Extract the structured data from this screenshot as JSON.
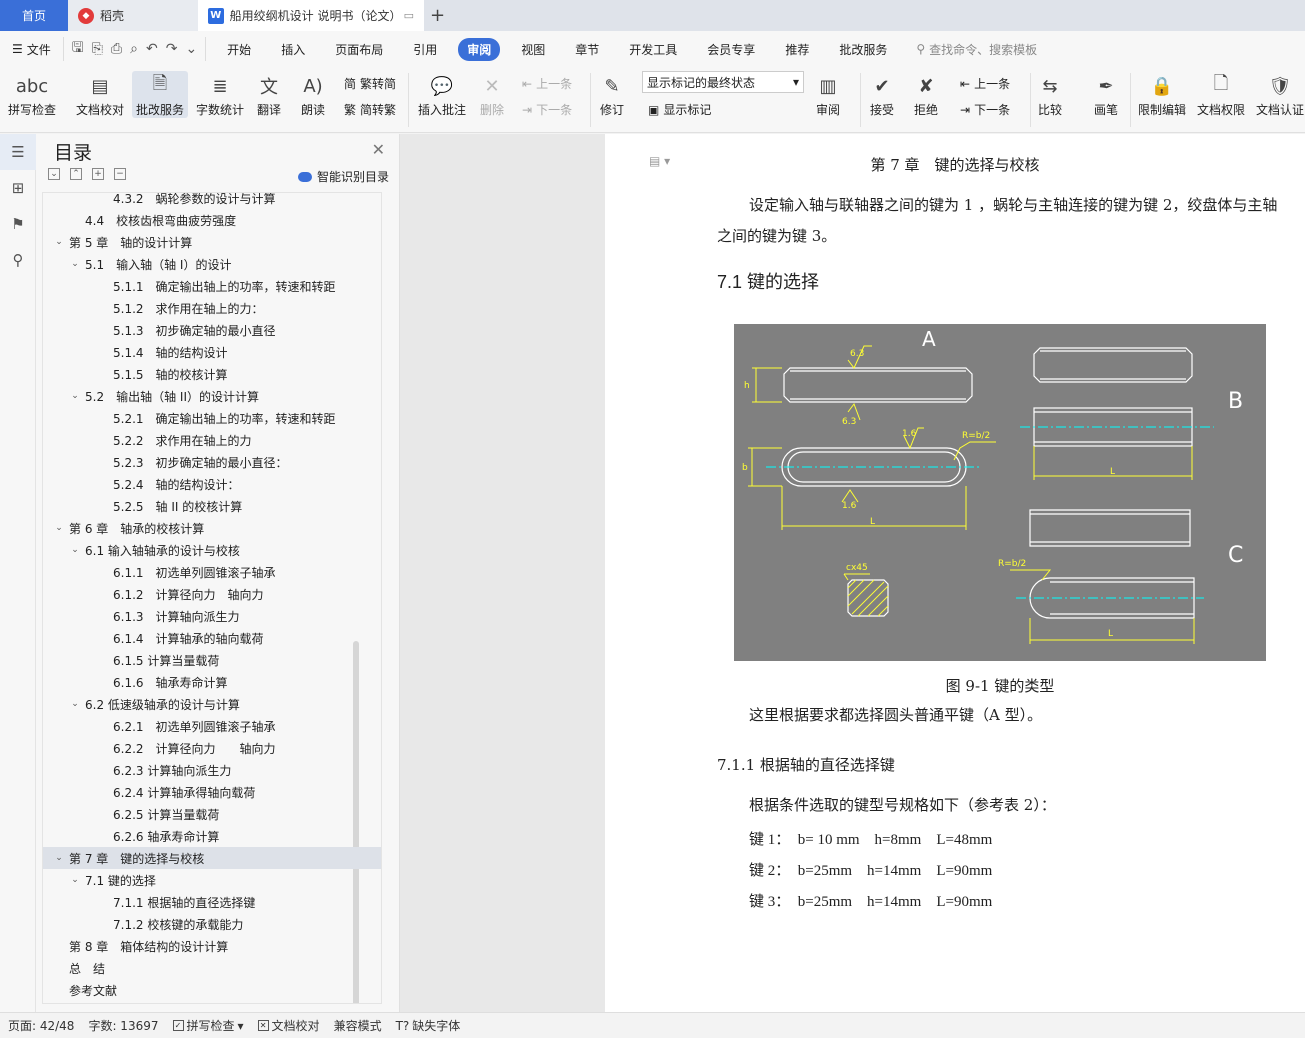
{
  "tabs": {
    "home": "首页",
    "daoke": "稻壳",
    "doc": "船用绞纲机设计 说明书（论文）",
    "plus": "+"
  },
  "menu": {
    "file": "文件",
    "items": [
      "开始",
      "插入",
      "页面布局",
      "引用",
      "审阅",
      "视图",
      "章节",
      "开发工具",
      "会员专享",
      "推荐",
      "批改服务"
    ],
    "active_index": 4,
    "search": "查找命令、搜索模板"
  },
  "ribbon": {
    "spell_check": "拼写检查",
    "doc_proof": "文档校对",
    "correction_service": "批改服务",
    "word_count": "字数统计",
    "translate": "翻译",
    "read_aloud": "朗读",
    "trad_to_simp": "繁转简",
    "simp_to_trad": "简转繁",
    "insert_comment": "插入批注",
    "delete": "删除",
    "prev": "上一条",
    "next": "下一条",
    "track": "修订",
    "markup_state": "显示标记的最终状态",
    "show_markup": "显示标记",
    "review": "审阅",
    "accept": "接受",
    "reject": "拒绝",
    "prev2": "上一条",
    "next2": "下一条",
    "compare": "比较",
    "pen": "画笔",
    "restrict_edit": "限制编辑",
    "doc_permission": "文档权限",
    "doc_cert": "文档认证"
  },
  "toc": {
    "title": "目录",
    "smart": "智能识别目录",
    "items": [
      {
        "text": "4.3.2　蜗轮参数的设计与计算",
        "level": 3,
        "chev": ""
      },
      {
        "text": "4.4　校核齿根弯曲疲劳强度",
        "level": 2,
        "chev": ""
      },
      {
        "text": "第 5 章　轴的设计计算",
        "level": 1,
        "chev": "v"
      },
      {
        "text": "5.1　输入轴（轴 I）的设计",
        "level": 2,
        "chev": "v"
      },
      {
        "text": "5.1.1　确定输出轴上的功率，转速和转距",
        "level": 3,
        "chev": ""
      },
      {
        "text": "5.1.2　求作用在轴上的力：",
        "level": 3,
        "chev": ""
      },
      {
        "text": "5.1.3　初步确定轴的最小直径",
        "level": 3,
        "chev": ""
      },
      {
        "text": "5.1.4　轴的结构设计",
        "level": 3,
        "chev": ""
      },
      {
        "text": "5.1.5　轴的校核计算",
        "level": 3,
        "chev": ""
      },
      {
        "text": "5.2　输出轴（轴 II）的设计计算",
        "level": 2,
        "chev": "v"
      },
      {
        "text": "5.2.1　确定输出轴上的功率，转速和转距",
        "level": 3,
        "chev": ""
      },
      {
        "text": "5.2.2　求作用在轴上的力",
        "level": 3,
        "chev": ""
      },
      {
        "text": "5.2.3　初步确定轴的最小直径：",
        "level": 3,
        "chev": ""
      },
      {
        "text": "5.2.4　轴的结构设计：",
        "level": 3,
        "chev": ""
      },
      {
        "text": "5.2.5　轴 II 的校核计算",
        "level": 3,
        "chev": ""
      },
      {
        "text": "第 6 章　轴承的校核计算",
        "level": 1,
        "chev": "v"
      },
      {
        "text": "6.1  输入轴轴承的设计与校核",
        "level": 2,
        "chev": "v"
      },
      {
        "text": "6.1.1　初选单列圆锥滚子轴承",
        "level": 3,
        "chev": ""
      },
      {
        "text": "6.1.2　计算径向力　轴向力",
        "level": 3,
        "chev": ""
      },
      {
        "text": "6.1.3　计算轴向派生力",
        "level": 3,
        "chev": ""
      },
      {
        "text": "6.1.4　计算轴承的轴向载荷",
        "level": 3,
        "chev": ""
      },
      {
        "text": "6.1.5  计算当量载荷",
        "level": 3,
        "chev": ""
      },
      {
        "text": "6.1.6　轴承寿命计算",
        "level": 3,
        "chev": ""
      },
      {
        "text": "6.2  低速级轴承的设计与计算",
        "level": 2,
        "chev": "v"
      },
      {
        "text": "6.2.1　初选单列圆锥滚子轴承",
        "level": 3,
        "chev": ""
      },
      {
        "text": "6.2.2　计算径向力　　轴向力",
        "level": 3,
        "chev": ""
      },
      {
        "text": "6.2.3  计算轴向派生力",
        "level": 3,
        "chev": ""
      },
      {
        "text": "6.2.4  计算轴承得轴向载荷",
        "level": 3,
        "chev": ""
      },
      {
        "text": "6.2.5  计算当量载荷",
        "level": 3,
        "chev": ""
      },
      {
        "text": "6.2.6  轴承寿命计算",
        "level": 3,
        "chev": ""
      },
      {
        "text": "第 7 章　键的选择与校核",
        "level": 1,
        "chev": "v",
        "selected": true
      },
      {
        "text": "7.1  键的选择",
        "level": 2,
        "chev": "v"
      },
      {
        "text": "7.1.1  根据轴的直径选择键",
        "level": 3,
        "chev": ""
      },
      {
        "text": "7.1.2  校核键的承载能力",
        "level": 3,
        "chev": ""
      },
      {
        "text": "第 8 章　箱体结构的设计计算",
        "level": 1,
        "chev": ""
      },
      {
        "text": "总　结",
        "level": 1,
        "chev": ""
      },
      {
        "text": "参考文献",
        "level": 1,
        "chev": ""
      }
    ]
  },
  "doc": {
    "chapter_title": "第 7 章　键的选择与校核",
    "intro": "设定输入轴与联轴器之间的键为 1 ，蜗轮与主轴连接的键为键 2，绞盘体与主轴之间的键为键 3。",
    "h_71": "7.1  键的选择",
    "figure": {
      "label_a": "A",
      "label_b": "B",
      "label_c": "C",
      "r_63_top": "6.3",
      "r_63_bot": "6.3",
      "r_16_top": "1.6",
      "r_16_bot": "1.6",
      "h": "h",
      "b": "b",
      "l1": "L",
      "l2": "L",
      "l3": "L",
      "r_b2_1": "R=b/2",
      "r_b2_2": "R=b/2",
      "chamfer": "cx45"
    },
    "caption": "图  9-1  键的类型",
    "choose": "这里根据要求都选择圆头普通平键（A 型）。",
    "h_711": "7.1.1  根据轴的直径选择键",
    "spec_intro": "根据条件选取的键型号规格如下（参考表 2）：",
    "spec1": "键 1：  b= 10 mm    h=8mm    L=48mm",
    "spec2": "键 2：  b=25mm    h=14mm    L=90mm",
    "spec3": "键 3：  b=25mm    h=14mm    L=90mm"
  },
  "status": {
    "page": "页面: 42/48",
    "words": "字数: 13697",
    "spell": "拼写检查",
    "proof": "文档校对",
    "compat": "兼容模式",
    "missing_font": "缺失字体"
  },
  "colors": {
    "accent": "#3a6fd8",
    "figure_bg": "#808080",
    "cad_yellow": "#ffff33",
    "cad_cyan": "#00ffff"
  }
}
